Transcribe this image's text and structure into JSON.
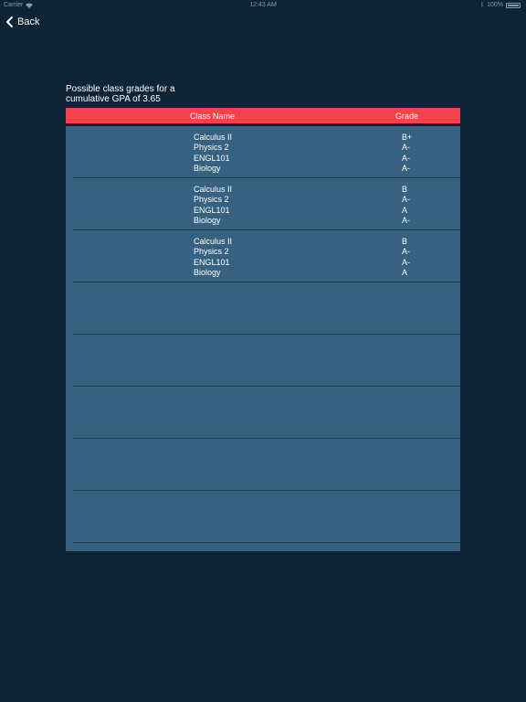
{
  "status_bar": {
    "carrier": "Carrier",
    "time": "12:43 AM",
    "battery": "100%"
  },
  "nav": {
    "back_label": "Back"
  },
  "subtitle": "Possible class grades for a cumulative GPA of 3.65",
  "table": {
    "headers": {
      "class_name": "Class Name",
      "grade": "Grade"
    },
    "rows": [
      {
        "entries": [
          {
            "class": "Calculus II",
            "grade": "B+"
          },
          {
            "class": "Physics 2",
            "grade": "A-"
          },
          {
            "class": "ENGL101",
            "grade": "A-"
          },
          {
            "class": "Biology",
            "grade": "A-"
          }
        ]
      },
      {
        "entries": [
          {
            "class": "Calculus II",
            "grade": "B"
          },
          {
            "class": "Physics 2",
            "grade": "A-"
          },
          {
            "class": "ENGL101",
            "grade": "A"
          },
          {
            "class": "Biology",
            "grade": "A-"
          }
        ]
      },
      {
        "entries": [
          {
            "class": "Calculus II",
            "grade": "B"
          },
          {
            "class": "Physics 2",
            "grade": "A-"
          },
          {
            "class": "ENGL101",
            "grade": "A-"
          },
          {
            "class": "Biology",
            "grade": "A"
          }
        ]
      },
      {
        "entries": []
      },
      {
        "entries": []
      },
      {
        "entries": []
      },
      {
        "entries": []
      },
      {
        "entries": []
      }
    ]
  },
  "colors": {
    "background": "#0c2436",
    "panel": "#366180",
    "accent": "#f5424b",
    "text": "#ffffff"
  }
}
